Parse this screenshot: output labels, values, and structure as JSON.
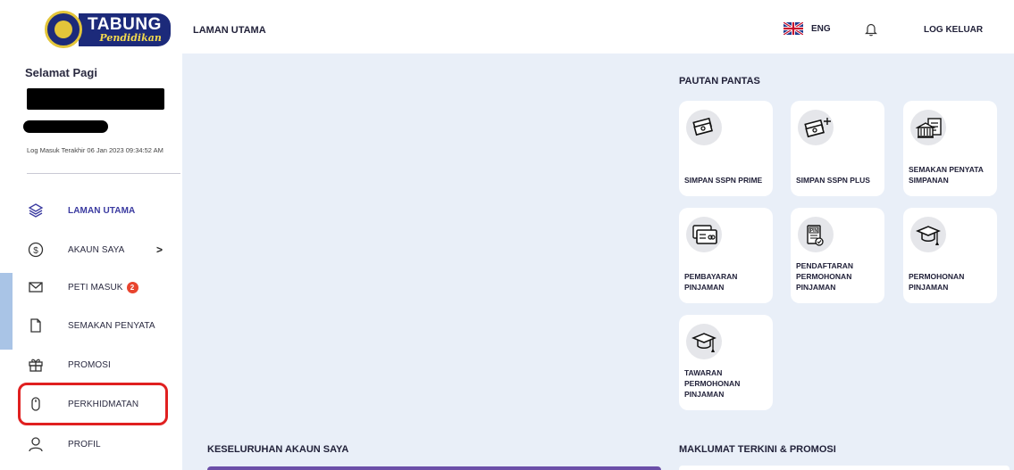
{
  "sidebar": {
    "logo": {
      "line1": "TABUNG",
      "line2": "Pendidikan"
    },
    "greeting": "Selamat Pagi",
    "last_login": "Log Masuk Terakhir 06 Jan 2023 09:34:52 AM",
    "items": [
      {
        "label": "LAMAN UTAMA",
        "icon": "layers-icon",
        "active": true
      },
      {
        "label": "AKAUN SAYA",
        "icon": "dollar-circle-icon",
        "chevron": ">"
      },
      {
        "label": "PETI MASUK",
        "icon": "mail-icon",
        "badge": "2"
      },
      {
        "label": "SEMAKAN PENYATA",
        "icon": "file-icon"
      },
      {
        "label": "PROMOSI",
        "icon": "gift-icon"
      },
      {
        "label": "PERKHIDMATAN",
        "icon": "mouse-icon"
      },
      {
        "label": "PROFIL",
        "icon": "user-icon"
      }
    ]
  },
  "header": {
    "title": "LAMAN UTAMA",
    "language": "ENG",
    "logout": "LOG KELUAR"
  },
  "main": {
    "quick_links_title": "PAUTAN PANTAS",
    "tiles": [
      {
        "label": "SIMPAN SSPN PRIME",
        "icon": "money-stack-icon"
      },
      {
        "label": "SIMPAN SSPN PLUS",
        "icon": "money-stack-plus-icon"
      },
      {
        "label": "SEMAKAN PENYATA SIMPANAN",
        "icon": "bank-statement-icon"
      },
      {
        "label": "PEMBAYARAN PINJAMAN",
        "icon": "card-payment-icon"
      },
      {
        "label": "PENDAFTARAN PERMOHONAN PINJAMAN",
        "icon": "pin-document-icon"
      },
      {
        "label": "PERMOHONAN PINJAMAN",
        "icon": "graduation-cap-icon"
      },
      {
        "label": "TAWARAN PERMOHONAN PINJAMAN",
        "icon": "graduation-cap-icon"
      }
    ],
    "accounts_title": "KESELURUHAN AKAUN SAYA",
    "news_title": "MAKLUMAT TERKINI & PROMOSI"
  },
  "colors": {
    "accent": "#3a3aa0",
    "main_bg": "#e9eff8",
    "badge": "#e8442e",
    "highlight": "#e02020"
  }
}
